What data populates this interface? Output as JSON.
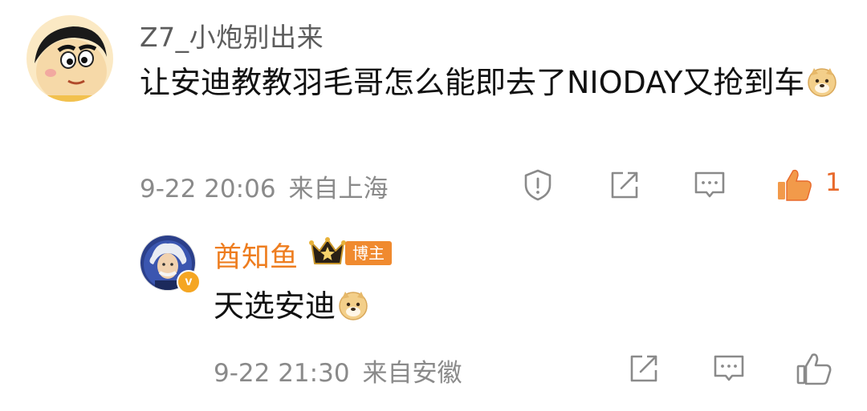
{
  "comment": {
    "username": "Z7_小炮别出来",
    "text": "让安迪教教羽毛哥怎么能即去了NIODAY又抢到车",
    "date": "9-22 20:06",
    "location": "来自上海",
    "like_count": "1",
    "icons": [
      "report-icon",
      "repost-icon",
      "reply-icon",
      "like-icon"
    ],
    "colors": {
      "like_active": "#e8692b",
      "meta_text": "#8a8a8a"
    }
  },
  "reply": {
    "username": "酋知鱼",
    "badge": "博主",
    "text": "天选安迪",
    "date": "9-22 21:30",
    "location": "来自安徽",
    "icons": [
      "repost-icon",
      "reply-icon",
      "like-icon"
    ],
    "colors": {
      "username": "#ee7d1f",
      "badge_bg": "#f08a2f"
    }
  }
}
